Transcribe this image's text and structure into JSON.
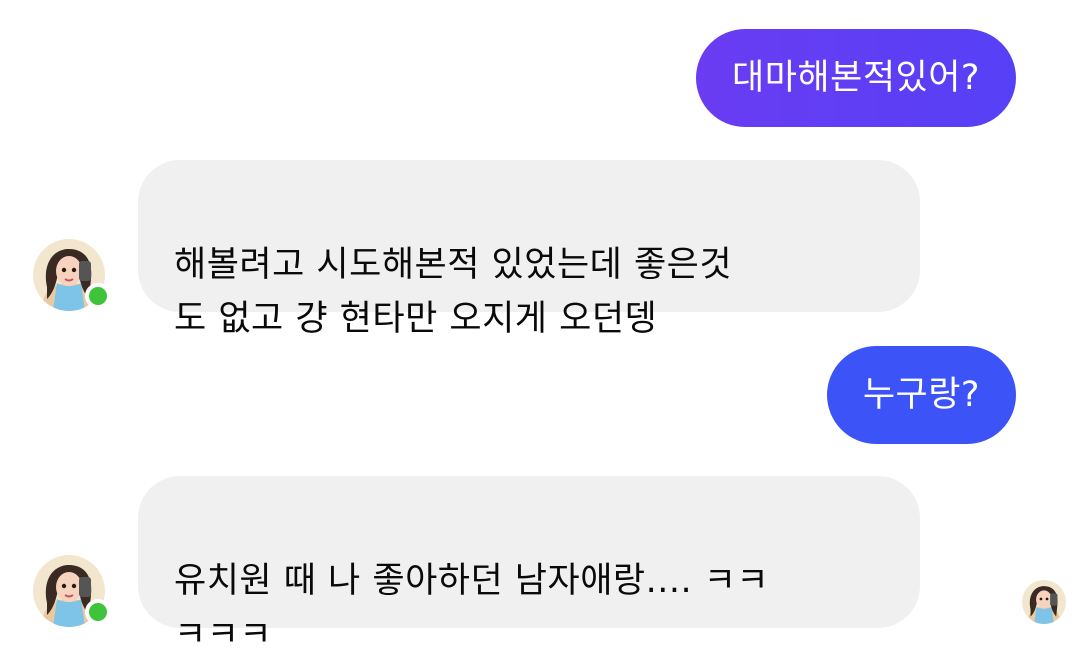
{
  "conversation": {
    "messages": [
      {
        "sender": "me",
        "text": "대마해본적있어?"
      },
      {
        "sender": "them",
        "text": "해볼려고 시도해본적 있었는데 좋은것\n도 없고 걍 현타만 오지게 오던뎅"
      },
      {
        "sender": "me",
        "text": "누구랑?"
      },
      {
        "sender": "them",
        "text": "유치원 때 나 좋아하던 남자애랑.... ㅋㅋ\nㅋㅋㅋ"
      }
    ]
  },
  "colors": {
    "outgoing_gradient_start": "#6a3cf2",
    "outgoing_gradient_end": "#5640f6",
    "outgoing_blue": "#3b53f7",
    "incoming_bg": "#f0f0f0",
    "online": "#3ec33a"
  },
  "icons": {
    "contact_avatar": "avatar-cartoon-girl",
    "online_status": "online-dot",
    "seen_receipt": "seen-avatar"
  }
}
